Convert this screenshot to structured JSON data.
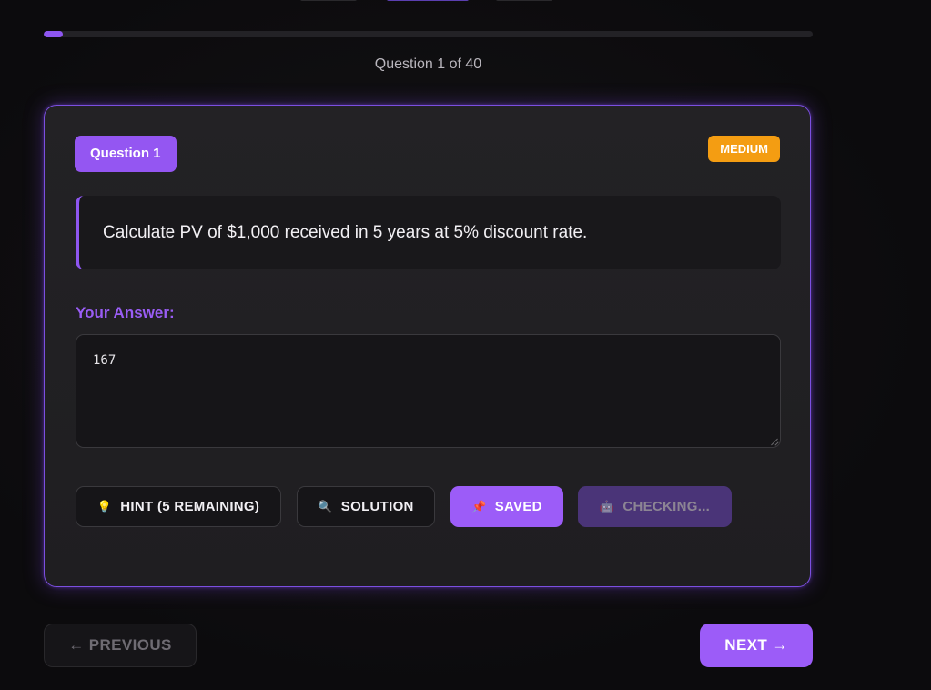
{
  "progress": {
    "counter_label": "Question 1 of 40",
    "fill_fraction": 0.025,
    "accent_color": "#8e56f0"
  },
  "question": {
    "badge": "Question 1",
    "difficulty": "MEDIUM",
    "difficulty_color": "#f49d12",
    "text": "Calculate PV of $1,000 received in 5 years at 5% discount rate."
  },
  "answer": {
    "label": "Your Answer:",
    "value": "167"
  },
  "actions": {
    "hint": {
      "icon": "lightbulb-icon",
      "label": "HINT (5 REMAINING)"
    },
    "solution": {
      "icon": "magnifier-icon",
      "label": "SOLUTION"
    },
    "saved": {
      "icon": "pushpin-icon",
      "label": "SAVED"
    },
    "checking": {
      "icon": "robot-icon",
      "label": "CHECKING..."
    }
  },
  "navigation": {
    "previous_label": "← PREVIOUS",
    "next_label": "NEXT →"
  }
}
